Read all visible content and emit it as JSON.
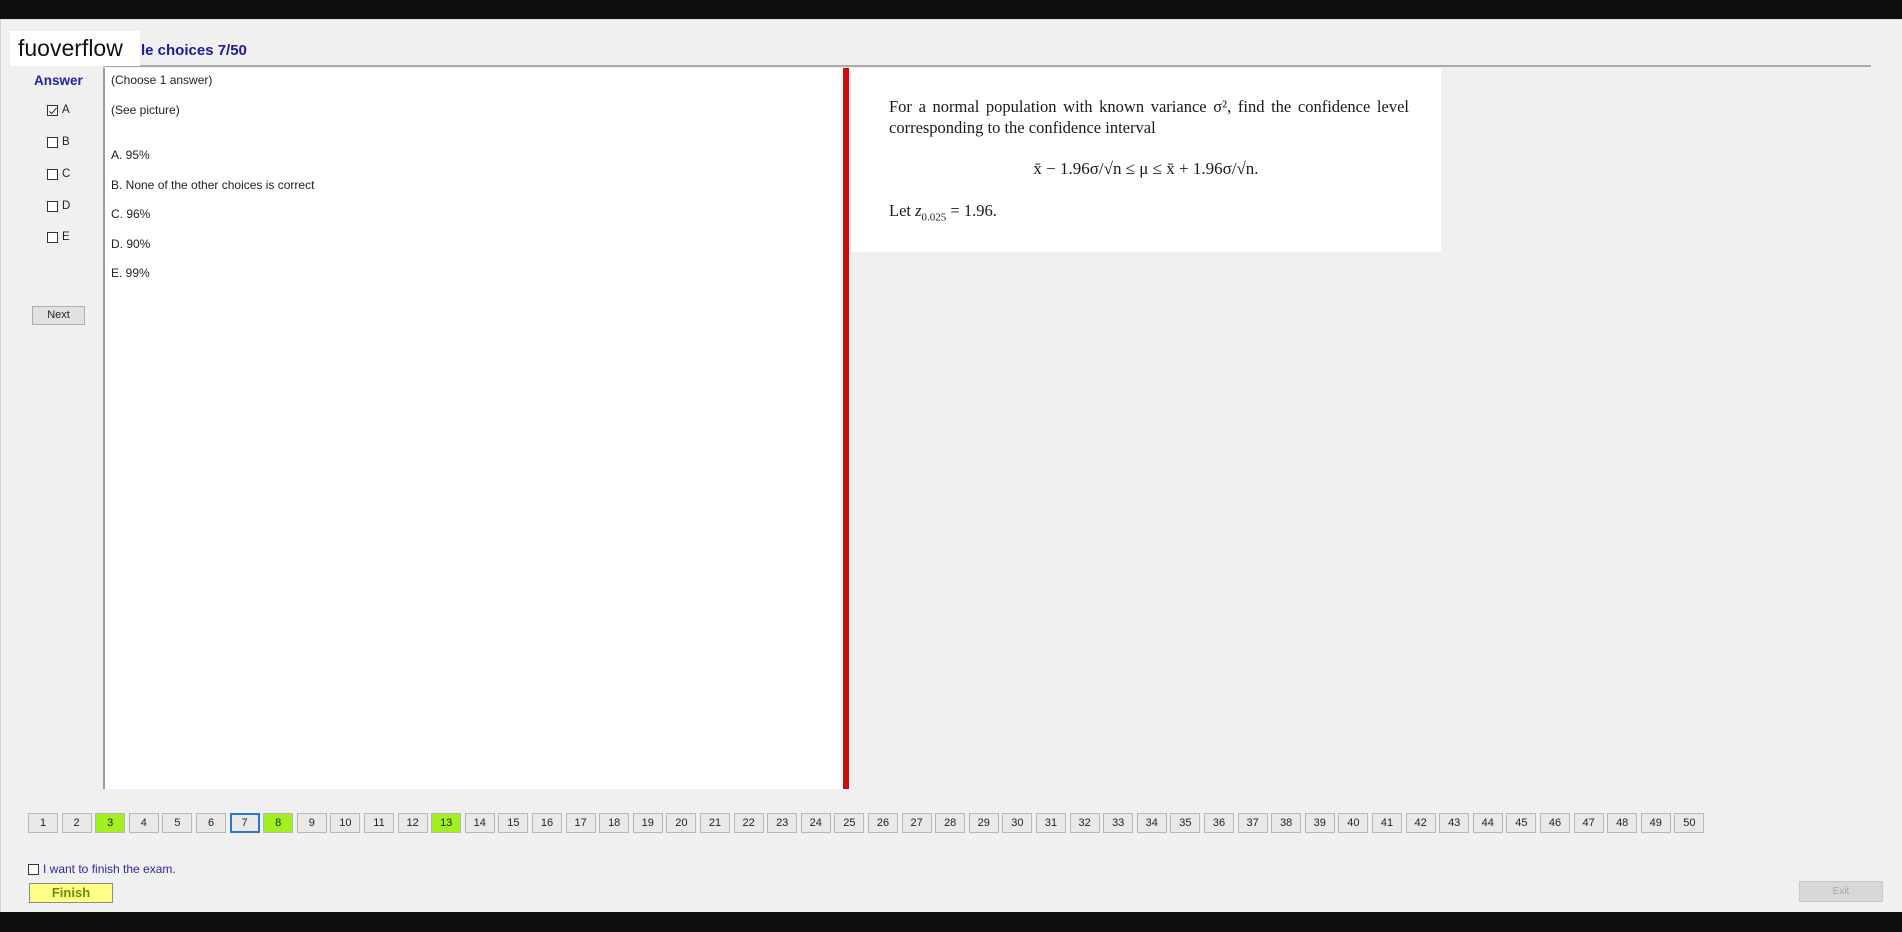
{
  "brand": "fuoverflow",
  "section_title": "le choices 7/50",
  "answer": {
    "title": "Answer",
    "options": [
      {
        "label": "A",
        "checked": true
      },
      {
        "label": "B",
        "checked": false
      },
      {
        "label": "C",
        "checked": false
      },
      {
        "label": "D",
        "checked": false
      },
      {
        "label": "E",
        "checked": false
      }
    ],
    "next_label": "Next"
  },
  "question": {
    "instruction": "(Choose 1 answer)",
    "see_picture": "(See picture)",
    "choices": [
      "A.  95%",
      "B.  None of the other choices is correct",
      "C.  96%",
      "D.  90%",
      "E.  99%"
    ]
  },
  "picture": {
    "text": "For a normal population with known variance σ², find the confidence level corresponding to the confidence interval",
    "formula": "x̄ − 1.96σ/√n ≤ μ ≤ x̄ + 1.96σ/√n.",
    "let_prefix": "Let",
    "let_symbol": "z",
    "let_subscript": "0.025",
    "let_value": " = 1.96."
  },
  "navigation": {
    "questions": [
      "1",
      "2",
      "3",
      "4",
      "5",
      "6",
      "7",
      "8",
      "9",
      "10",
      "11",
      "12",
      "13",
      "14",
      "15",
      "16",
      "17",
      "18",
      "19",
      "20",
      "21",
      "22",
      "23",
      "24",
      "25",
      "26",
      "27",
      "28",
      "29",
      "30",
      "31",
      "32",
      "33",
      "34",
      "35",
      "36",
      "37",
      "38",
      "39",
      "40",
      "41",
      "42",
      "43",
      "44",
      "45",
      "46",
      "47",
      "48",
      "49",
      "50"
    ],
    "answered": [
      "3",
      "8",
      "13"
    ],
    "current": "7"
  },
  "finish": {
    "checkbox_label": "I want to finish the exam.",
    "finish_label": "Finish",
    "exit_label": "Exit"
  }
}
